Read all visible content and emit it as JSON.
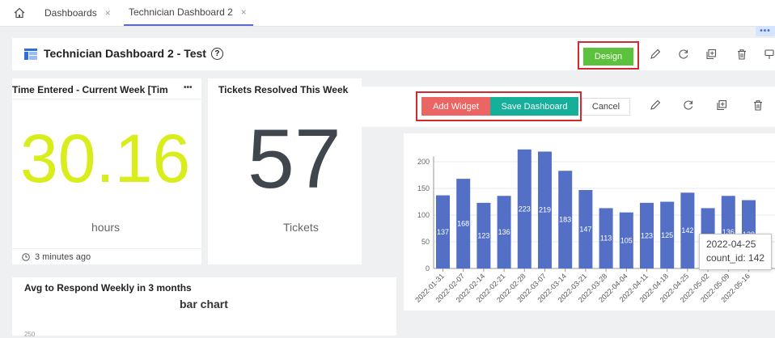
{
  "tabs": {
    "items": [
      {
        "label": "Dashboards"
      },
      {
        "label": "Technician Dashboard 2"
      }
    ],
    "close_glyph": "×"
  },
  "badge": {
    "dots": "•••"
  },
  "header": {
    "title": "Technician Dashboard 2 - Test",
    "help": "?",
    "design_label": "Design"
  },
  "widgets": {
    "time_entered": {
      "title": "Time Entered - Current Week [Tim",
      "more": "•••",
      "value": "30.16",
      "unit": "hours",
      "updated": "3 minutes ago",
      "value_color": "#d9ec1c"
    },
    "tickets": {
      "title": "Tickets Resolved This Week",
      "value": "57",
      "unit": "Tickets",
      "value_color": "#40464d"
    },
    "avg_respond": {
      "title": "Avg to Respond Weekly in 3 months",
      "subtitle": "bar chart",
      "axis_tick": "250"
    }
  },
  "toolbar": {
    "add_widget": "Add Widget",
    "save_dashboard": "Save Dashboard",
    "cancel": "Cancel"
  },
  "tooltip": {
    "date": "2022-04-25",
    "text": "count_id: 142"
  },
  "colors": {
    "bar": "#5470c6",
    "design": "#5cc23d",
    "add": "#ec6565",
    "save": "#16b09a",
    "highlight": "#d22a2f"
  },
  "chart_data": {
    "type": "bar",
    "categories": [
      "2022-01-31",
      "2022-02-07",
      "2022-02-14",
      "2022-02-21",
      "2022-02-28",
      "2022-03-07",
      "2022-03-14",
      "2022-03-21",
      "2022-03-28",
      "2022-04-04",
      "2022-04-11",
      "2022-04-18",
      "2022-04-25",
      "2022-05-02",
      "2022-05-09",
      "2022-05-16"
    ],
    "values": [
      137,
      168,
      123,
      136,
      223,
      219,
      183,
      147,
      113,
      105,
      123,
      125,
      142,
      113,
      136,
      128
    ],
    "yticks": [
      0,
      50,
      100,
      150,
      200
    ],
    "ylim": [
      0,
      230
    ],
    "grid": true,
    "data_labels": true
  }
}
